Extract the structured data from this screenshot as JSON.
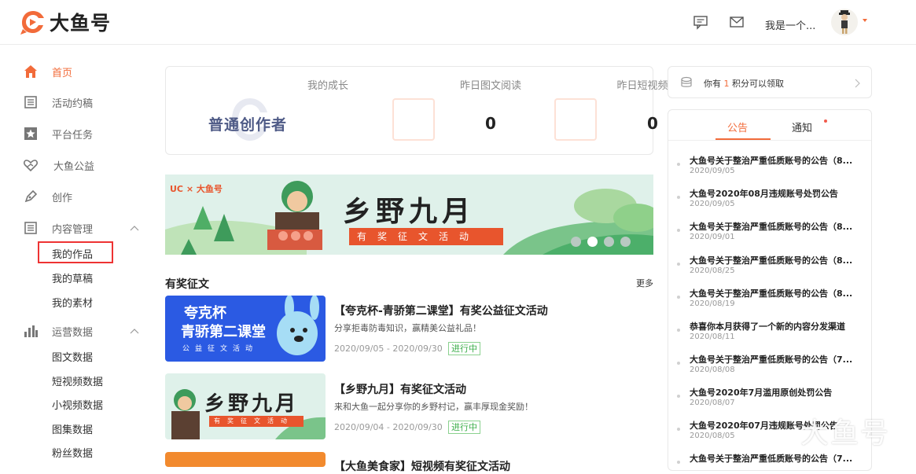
{
  "header": {
    "brand": "大鱼号",
    "username": "我是一个...",
    "icons": [
      "message-icon",
      "mail-icon"
    ],
    "accent": "#f26b3a"
  },
  "sidebar": {
    "items": [
      {
        "label": "首页",
        "icon": "home-icon",
        "active": true
      },
      {
        "label": "活动约稿",
        "icon": "document-icon"
      },
      {
        "label": "平台任务",
        "icon": "star-icon"
      },
      {
        "label": "大鱼公益",
        "icon": "heart-hands-icon"
      },
      {
        "label": "创作",
        "icon": "pen-icon"
      },
      {
        "label": "内容管理",
        "icon": "list-icon",
        "expanded": true
      },
      {
        "label": "运营数据",
        "icon": "chart-icon",
        "expanded": true
      }
    ],
    "content_sub": [
      "我的作品",
      "我的草稿",
      "我的素材"
    ],
    "data_sub": [
      "图文数据",
      "短视频数据",
      "小视频数据",
      "图集数据",
      "粉丝数据"
    ]
  },
  "stats": {
    "growth_title": "我的成长",
    "growth_level": "普通创作者",
    "article_title": "昨日图文阅读",
    "article_value": "0",
    "video_title": "昨日短视频播放",
    "video_value": "0"
  },
  "banner": {
    "partner": "UC × 大鱼号",
    "title": "乡野九月",
    "strip": "有奖征文活动",
    "slide_count": 4,
    "active_slide": 1
  },
  "activities": {
    "section_title": "有奖征文",
    "more": "更多",
    "items": [
      {
        "title": "【夸克杯-青骄第二课堂】有奖公益征文活动",
        "desc": "分享拒毒防毒知识，赢精美公益礼品！",
        "date": "2020/09/05 - 2020/09/30",
        "status": "进行中",
        "thumb_line1": "夸克杯",
        "thumb_line2": "青骄第二课堂",
        "thumb_strip": "公益征文活动"
      },
      {
        "title": "【乡野九月】有奖征文活动",
        "desc": "来和大鱼一起分享你的乡野村记，赢丰厚现金奖励！",
        "date": "2020/09/04 - 2020/09/30",
        "status": "进行中",
        "thumb_line1": "乡野九月",
        "thumb_strip": "有奖征文活动"
      },
      {
        "title": "【大鱼美食家】短视频有奖征文活动"
      }
    ]
  },
  "points": {
    "prefix": "你有",
    "count": "1",
    "suffix": "积分可以领取"
  },
  "notices": {
    "tab_announce": "公告",
    "tab_notify": "通知",
    "items": [
      {
        "title": "大鱼号关于整治严重低质账号的公告（8...",
        "date": "2020/09/05"
      },
      {
        "title": "大鱼号2020年08月违规账号处罚公告",
        "date": "2020/09/05"
      },
      {
        "title": "大鱼号关于整治严重低质账号的公告（8...",
        "date": "2020/09/01"
      },
      {
        "title": "大鱼号关于整治严重低质账号的公告（8...",
        "date": "2020/08/25"
      },
      {
        "title": "大鱼号关于整治严重低质账号的公告（8...",
        "date": "2020/08/19"
      },
      {
        "title": "恭喜你本月获得了一个新的内容分发渠道",
        "date": "2020/08/11"
      },
      {
        "title": "大鱼号关于整治严重低质账号的公告（7...",
        "date": "2020/08/08"
      },
      {
        "title": "大鱼号2020年7月滥用原创处罚公告",
        "date": "2020/08/07"
      },
      {
        "title": "大鱼号2020年07月违规账号处罚公告",
        "date": "2020/08/05"
      },
      {
        "title": "大鱼号关于整治严重低质账号的公告（7...",
        "date": ""
      }
    ]
  },
  "watermark": "大鱼号"
}
